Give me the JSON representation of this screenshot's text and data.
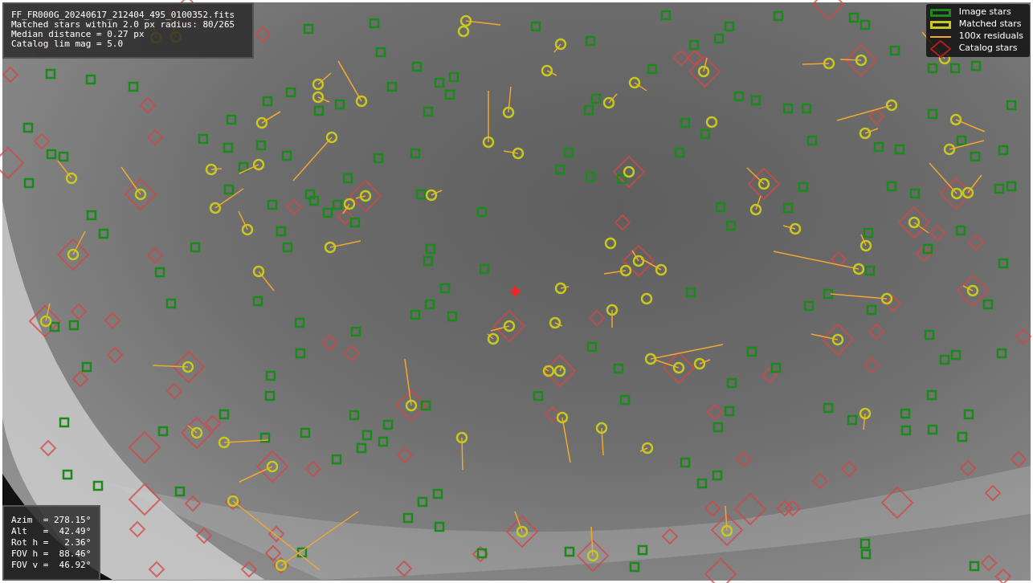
{
  "info": {
    "lines": [
      "FF_FR000G_20240617_212404_495_0100352.fits",
      "Matched stars within 2.0 px radius: 80/265",
      "Median distance = 0.27 px",
      "Catalog lim mag = 5.0"
    ]
  },
  "legend": [
    {
      "kind": "image",
      "label": "Image stars"
    },
    {
      "kind": "matched",
      "label": "Matched stars"
    },
    {
      "kind": "residual",
      "label": "100x residuals"
    },
    {
      "kind": "catalog",
      "label": "Catalog stars"
    }
  ],
  "pointing": {
    "lines": [
      "Azim  = 278.15°",
      "Alt   =  42.49°",
      "Rot h =   2.36°",
      "FOV h =  88.46°",
      "FOV v =  46.92°"
    ]
  }
}
